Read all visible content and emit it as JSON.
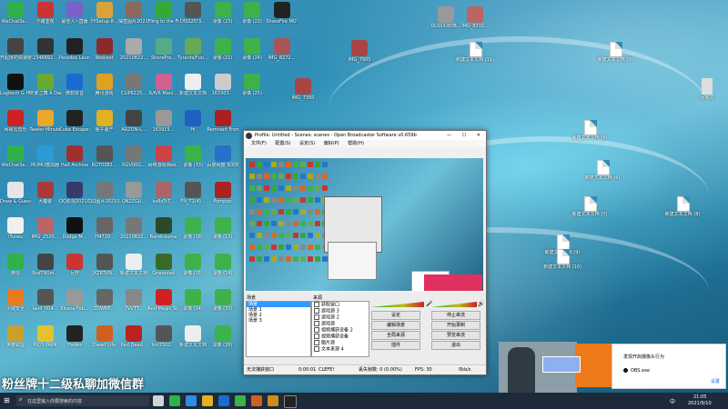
{
  "desktop": {
    "left_icons": [
      [
        "WeChatSe...",
        "#2fb24a"
      ],
      [
        "卡路亚观",
        "#c33"
      ],
      [
        "最佳人~直播",
        "#7b61c9"
      ],
      [
        "YYSetup-8...",
        "#d9a33a"
      ],
      [
        "抽签图片20210820...",
        "#8a6a5a"
      ],
      [
        "Fling to the Finish 整体",
        "#3a3"
      ],
      [
        "DISS25!3...",
        "#555"
      ],
      [
        "录像 (23)",
        "#3db24a"
      ],
      [
        "录像 (22)",
        "#3db24a"
      ],
      [
        "ShareFire MOTIV",
        "#222"
      ],
      [
        "开起序的快速链接",
        "#444"
      ],
      [
        "2346692...",
        "#333"
      ],
      [
        "Paradox Launcher v2",
        "#222"
      ],
      [
        "Weblest",
        "#8a2a2a"
      ],
      [
        "20210822...",
        "#aaa"
      ],
      [
        "ShorePro...",
        "#5a8"
      ],
      [
        "Tyrants/Fun...",
        "#6a5"
      ],
      [
        "录像 (21)",
        "#3db24a"
      ],
      [
        "录像 (24)",
        "#3db24a"
      ],
      [
        "IMG_8272...",
        "#a55"
      ],
      [
        "Logitech G HUB",
        "#111"
      ],
      [
        "天使之舞 A Dance of F...",
        "#6a3"
      ],
      [
        "微软拼音",
        "#1a6bd0"
      ],
      [
        "腾讯游戏",
        "#e0a020"
      ],
      [
        "CLIP6225...",
        "#777"
      ],
      [
        "6/6/6 Mani...",
        "#d06090"
      ],
      [
        "新建文本文档",
        "#eee"
      ],
      [
        "163303...",
        "#ccc"
      ],
      [
        "录像 (25)",
        "#3db24a"
      ],
      [
        "",
        "#000"
      ],
      [
        "网易云音乐",
        "#d02020"
      ],
      [
        "Tawler Minutes",
        "#eba72a"
      ],
      [
        "Cube Escape: ...",
        "#222"
      ],
      [
        "猴子速产",
        "#e2b020"
      ],
      [
        "ARZON-L...",
        "#444"
      ],
      [
        "163915...",
        "#999"
      ],
      [
        "Hi",
        "#2060c0"
      ],
      [
        "Remnant From t...",
        "#aa2020"
      ],
      [
        "",
        "#000"
      ],
      [
        "",
        "#000"
      ],
      [
        "WeChatSe...",
        "#2fb24a"
      ],
      [
        "MUMU模拟器",
        "#2a9ad9"
      ],
      [
        "Half Archive",
        "#a03030"
      ],
      [
        "RGT0382...",
        "#555"
      ],
      [
        "RGV00G...",
        "#777"
      ],
      [
        "网络游戏Web...",
        "#c44"
      ],
      [
        "录像 (33)",
        "#3db24a"
      ],
      [
        "百度网盘 3ODE...",
        "#2a70c9"
      ],
      [
        "",
        "#000"
      ],
      [
        "",
        "#000"
      ],
      [
        "Draw & Guess",
        "#e6e6e6"
      ],
      [
        "大魔装",
        "#aa3a3a"
      ],
      [
        "QQ影视20210809...",
        "#3a3a6a"
      ],
      [
        "QQ图片20210809...",
        "#777"
      ],
      [
        "QN2ZGU...",
        "#999"
      ],
      [
        "ks8xTcT...",
        "#a66"
      ],
      [
        "FN_T1(4)...",
        "#555"
      ],
      [
        "Pompon",
        "#a22"
      ],
      [
        "",
        "#000"
      ],
      [
        "",
        "#000"
      ],
      [
        "iTunes",
        "#f0f0f0"
      ],
      [
        "IMG_2520...",
        "#b66"
      ],
      [
        "Dodge M...",
        "#111"
      ],
      [
        "7f4710...",
        "#666"
      ],
      [
        "20210822...",
        "#777"
      ],
      [
        "Barotrauma",
        "#2a4a2a"
      ],
      [
        "录像 (18)",
        "#3db24a"
      ],
      [
        "录像 (12)",
        "#3db24a"
      ],
      [
        "",
        "#000"
      ],
      [
        "",
        "#000"
      ],
      [
        "微信",
        "#2fb24a"
      ],
      [
        "0taiT9Gm...",
        "#444"
      ],
      [
        "互轩",
        "#c33"
      ],
      [
        "JXZRTVN...",
        "#555"
      ],
      [
        "新建文本文档",
        "#eee"
      ],
      [
        "Grounded",
        "#3a6a2a"
      ],
      [
        "录像 (15)",
        "#3db24a"
      ],
      [
        "录像 (14)",
        "#3db24a"
      ],
      [
        "",
        "#000"
      ],
      [
        "",
        "#000"
      ],
      [
        "火绒安全",
        "#ea7a20"
      ],
      [
        "land_004...",
        "#555"
      ],
      [
        "Kitana Feb...",
        "#999"
      ],
      [
        "ZDWRE...",
        "#666"
      ],
      [
        "7VVTT...",
        "#888"
      ],
      [
        "Red Magic Studio",
        "#d02020"
      ],
      [
        "录像 (34)",
        "#3db24a"
      ],
      [
        "录像 (32)",
        "#3db24a"
      ],
      [
        "",
        "#000"
      ],
      [
        "",
        "#000"
      ],
      [
        "英雄联盟",
        "#c9a030"
      ],
      [
        "PICO PARK",
        "#e2c230"
      ],
      [
        "Hades",
        "#222"
      ],
      [
        "Dwarf Life",
        "#d06020"
      ],
      [
        "Red Dead...",
        "#b22"
      ],
      [
        "lnd3302...",
        "#555"
      ],
      [
        "新建文本文档",
        "#eee"
      ],
      [
        "录像 (26)",
        "#3db24a"
      ],
      [
        "",
        "#000"
      ],
      [
        "",
        "#000"
      ]
    ],
    "top_right_items": [
      [
        "DLSSX-BOB...",
        "#999"
      ],
      [
        "IMG_8310...",
        "#b66"
      ]
    ],
    "right_file_labels": [
      "新建文本文档 (11)",
      "新建文本文档 (3)",
      "新建文本文档 (5)",
      "新建文本文档 (6)",
      "新建文本文档 (7)",
      "新建文本文档 (8)",
      "新建文本文档 (9)",
      "新建文本文档 (10)"
    ],
    "recycle_bin": "回收站",
    "img_7905": "IMG_7905",
    "img_7350": "IMG_7350"
  },
  "obs": {
    "title": "Profile: Untitled - Scenes: scenes - Open Broadcaster Software v0.659b",
    "menu": [
      "文件(F)",
      "配置(S)",
      "设定(S)",
      "偏好(P)",
      "帮助(H)"
    ],
    "scenes_label": "场景",
    "sources_label": "来源",
    "scenes": [
      "场景",
      "场景 1",
      "场景 2",
      "场景 3"
    ],
    "sources": [
      "获取窗口",
      "游戏源 3",
      "游戏源 2",
      "游戏源",
      "视频捕获设备 2",
      "视频捕获设备",
      "图片源",
      "文本来源 4"
    ],
    "buttons": {
      "settings": "设定",
      "stop_stream": "停止串流",
      "edit_scene": "编辑场景",
      "start_record": "开始录制",
      "global_source": "全局来源",
      "preview": "预览串流",
      "plugins": "插件",
      "exit": "退出"
    },
    "status": {
      "window_capture": "无法捕获窗口",
      "time": "0:00:01",
      "fps_label": "CLEFE!",
      "dropped": "丢失帧数: 0 (0.00%)",
      "fps": "FPS: 30",
      "bitrate": "0kb/s"
    }
  },
  "overlay_text": "粉丝牌十二级私聊加微信群",
  "taskbar": {
    "search_placeholder": "在这里输入你要搜索的内容",
    "time": "21:05",
    "date": "2021/9/10",
    "lang": "中"
  },
  "notification": {
    "title": "发现开启摄像头行为",
    "app": "OBS.exe",
    "action": "设置"
  }
}
